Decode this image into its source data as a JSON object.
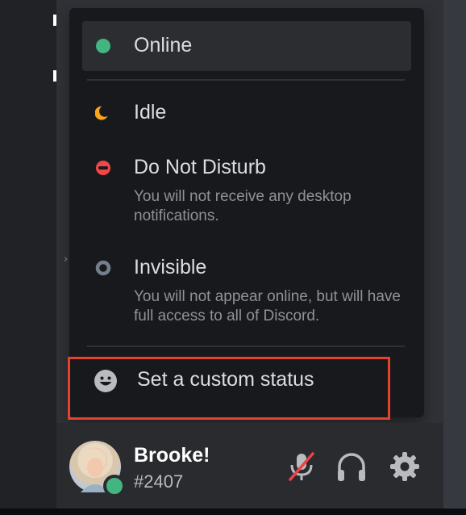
{
  "status_menu": {
    "items": [
      {
        "label": "Online",
        "description": "",
        "color": "#43b581",
        "icon": "online-dot-icon",
        "selected": true
      },
      {
        "label": "Idle",
        "description": "",
        "color": "#faa61a",
        "icon": "idle-moon-icon",
        "selected": false
      },
      {
        "label": "Do Not Disturb",
        "description": "You will not receive any desktop notifications.",
        "color": "#f04747",
        "icon": "dnd-icon",
        "selected": false
      },
      {
        "label": "Invisible",
        "description": "You will not appear online, but will have full access to all of Discord.",
        "color": "#747f8d",
        "icon": "invisible-ring-icon",
        "selected": false
      }
    ],
    "custom_status": {
      "label": "Set a custom status",
      "icon": "smiley-icon"
    }
  },
  "user_panel": {
    "username": "Brooke!",
    "discriminator": "#2407",
    "status_color": "#43b581",
    "controls": [
      {
        "name": "mute-microphone-icon",
        "state": "muted"
      },
      {
        "name": "headphones-icon"
      },
      {
        "name": "settings-gear-icon"
      }
    ]
  },
  "annotation": {
    "highlight_color": "#e5422e"
  }
}
